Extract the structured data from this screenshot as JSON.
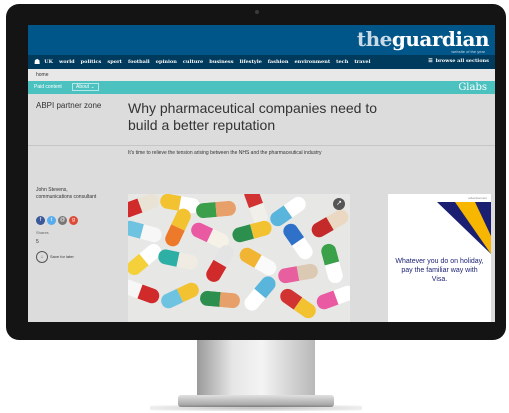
{
  "brand": {
    "the": "the",
    "name": "guardian",
    "tagline": "website of the year"
  },
  "nav": {
    "home_icon": "home-icon",
    "items": [
      "UK",
      "world",
      "politics",
      "sport",
      "football",
      "opinion",
      "culture",
      "business",
      "lifestyle",
      "fashion",
      "environment",
      "tech",
      "travel"
    ],
    "browse_label": "browse all sections",
    "browse_icon": "menu-icon"
  },
  "breadcrumb": {
    "label": "home"
  },
  "labs": {
    "paid_label": "Paid content",
    "about_label": "About ⌄",
    "logo": "Glabs"
  },
  "article": {
    "partner_zone": "ABPI partner zone",
    "headline": "Why pharmaceutical companies need to build a better reputation",
    "standfirst": "It's time to relieve the tension arising between the NHS and the pharmaceutical industry",
    "author_name": "John Stevens,",
    "author_role": "communications consultant",
    "social_icons": [
      "facebook-icon",
      "twitter-icon",
      "email-icon",
      "google-plus-icon"
    ],
    "share_label": "Shares",
    "share_count": "5",
    "save_label": "Save for later"
  },
  "ad": {
    "label": "advertisement",
    "text": "Whatever you do on holiday, pay the familiar way with Visa.",
    "colors": {
      "navy": "#1a1f71",
      "gold": "#f7b600"
    }
  },
  "colors": {
    "masthead": "#005689",
    "nav": "#003a5c",
    "labs_teal": "#4cc2c0"
  }
}
